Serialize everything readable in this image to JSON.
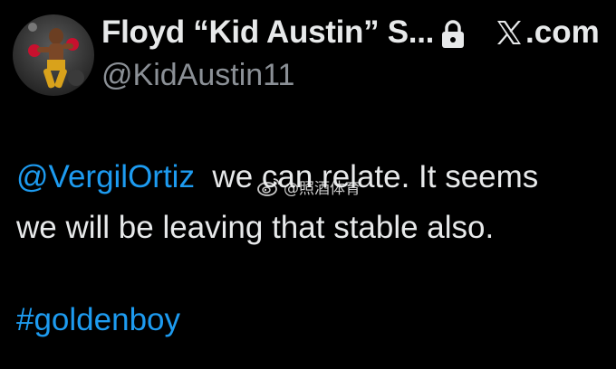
{
  "author": {
    "display_name": "Floyd “Kid Austin” S...",
    "handle": "@KidAustin11",
    "avatar_icon": "boxer-avatar-icon",
    "verified_icon": "lock-icon"
  },
  "platform": {
    "label": "𝕏.com",
    "logo_icon": "x-logo-icon"
  },
  "tweet": {
    "mention": "@VergilOrtiz",
    "line1_rest": "we can relate. It seems",
    "line2": "we will be leaving that stable also.",
    "hashtag": "#goldenboy"
  },
  "watermark": {
    "text": "@照酒体育",
    "icon": "weibo-icon"
  },
  "colors": {
    "background": "#000000",
    "text": "#e7e9ea",
    "secondary": "#8b9096",
    "link": "#1d9bf0"
  }
}
